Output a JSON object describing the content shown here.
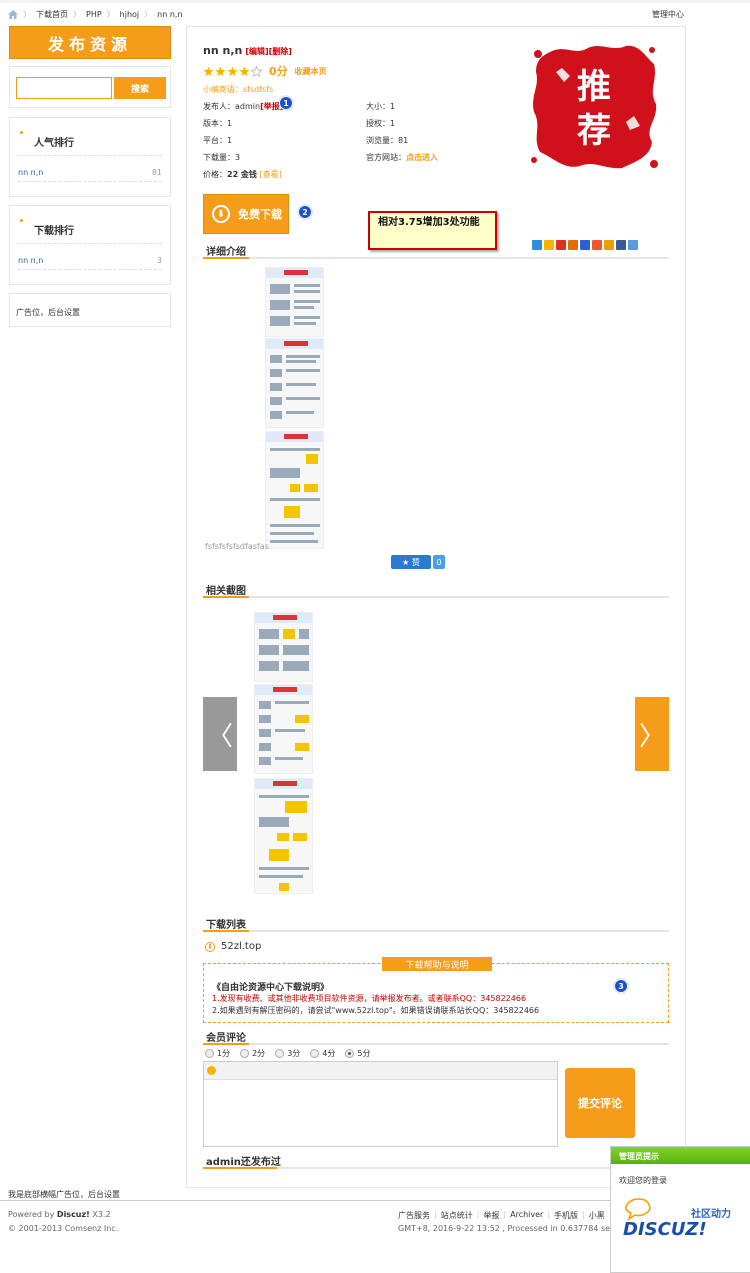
{
  "breadcrumb": {
    "items": [
      "下载首页",
      "PHP",
      "hjhoj",
      "nn n,n"
    ]
  },
  "header": {
    "admin_center": "管理中心"
  },
  "sidebar": {
    "publish_label": "发布资源",
    "search_placeholder": "",
    "search_button": "搜索",
    "popular": {
      "title": "人气排行",
      "items": [
        {
          "name": "nn n,n",
          "count": "81"
        }
      ]
    },
    "downloads": {
      "title": "下载排行",
      "items": [
        {
          "name": "nn n,n",
          "count": "3"
        }
      ]
    },
    "ad_text": "广告位，后台设置"
  },
  "resource": {
    "title": "nn n,n",
    "edit_label": "[编辑][删除]",
    "rating_stars": 4,
    "rating_max": 5,
    "score": "0分",
    "favorite": "收藏本页",
    "editor_review": "小编寄语：sfsdfsfs",
    "publisher_label": "发布人：",
    "publisher": "admin",
    "report": "[举报]",
    "version": "版本：1",
    "platform": "平台：1",
    "downloads": "下载量：3",
    "price_label": "价格：",
    "price": "22 金钱",
    "price_view": "[查看]",
    "size": "大小：1",
    "license": "授权：1",
    "views": "浏览量：81",
    "website_label": "官方网站：",
    "website_link": "点击进入",
    "stamp_text": "推荐",
    "badge1": "1",
    "badge2": "2",
    "badge3": "3",
    "download_btn": "免费下载",
    "annotation": "相对3.75增加3处功能"
  },
  "sections": {
    "detail": "详细介绍",
    "screenshots": "相关截图",
    "download_list": "下载列表",
    "comments": "会员评论",
    "admin_published": "admin还发布过"
  },
  "detail": {
    "caption": "fsfsfsfsfsdfasfas",
    "like_label": "赞",
    "like_count": "0"
  },
  "download_list": {
    "item": "52zl.top"
  },
  "help": {
    "tag": "下载帮助与说明",
    "title": "《自由论资源中心下载说明》",
    "line1": "1.发现有收费、或其他非收费项目软件资源，请举报发布者。或者联系QQ：345822466",
    "line2": "2.如果遇到有解压密码的，请尝试\"www.52zl.top\"。如果错误请联系站长QQ：345822466"
  },
  "comment": {
    "options": [
      "1分",
      "2分",
      "3分",
      "4分",
      "5分"
    ],
    "selected": "5分",
    "submit": "提交评论"
  },
  "footer": {
    "ad": "我是底部横幅广告位，后台设置",
    "powered_prefix": "Powered by ",
    "powered_brand": "Discuz!",
    "powered_version": " X3.2",
    "copyright": "© 2001-2013 Comsenz Inc.",
    "links": [
      "广告服务",
      "站点统计",
      "举报",
      "Archiver",
      "手机版",
      "小黑"
    ],
    "gmt": "GMT+8, 2016-9-22 13:52 , Processed in 0.637784 sec"
  },
  "admin_popup": {
    "title": "管理员提示",
    "message": "欢迎您的登录",
    "logo_text": "社区动力",
    "logo_brand": "DISCUZ!"
  },
  "colors": {
    "accent": "#f59c1a",
    "link_red": "#cc0000",
    "popup_green": "#6bc21a"
  }
}
